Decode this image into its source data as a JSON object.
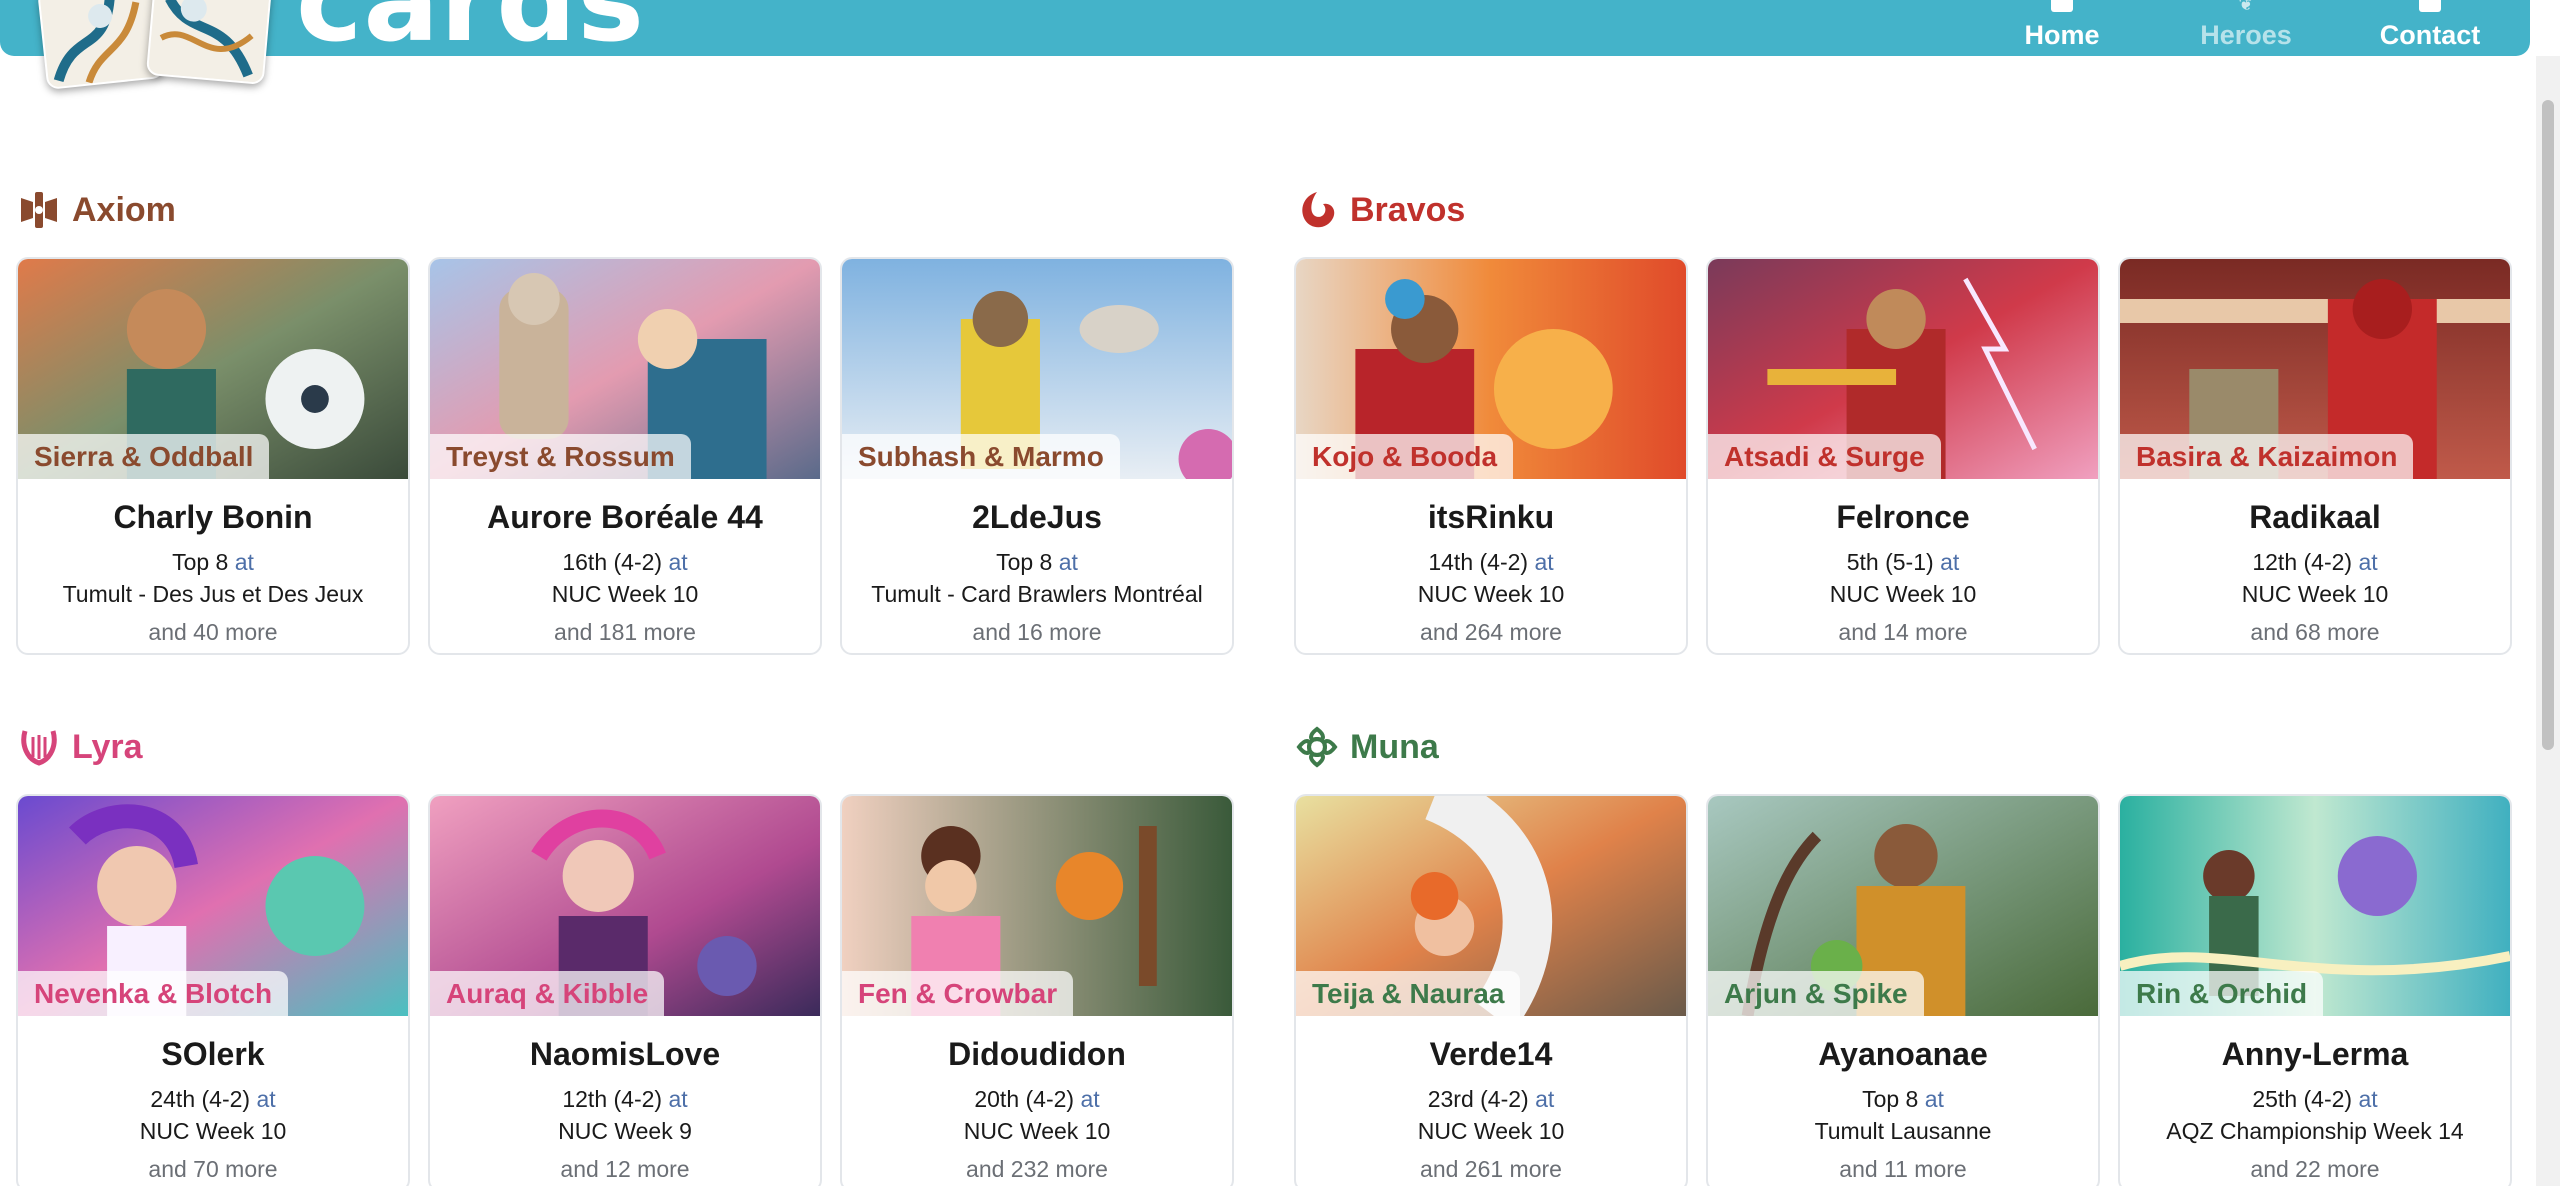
{
  "header": {
    "brand": "cards",
    "nav": [
      {
        "label": "Home",
        "icon": "home-icon"
      },
      {
        "label": "Heroes",
        "icon": "laurel-icon"
      },
      {
        "label": "Contact",
        "icon": "mail-icon"
      }
    ]
  },
  "colors": {
    "header": "#44b3c9",
    "axiom": "#8a4a2e",
    "bravos": "#c0312c",
    "lyra": "#d6447a",
    "muna": "#3d7a4a",
    "at_link": "#4d6fa8"
  },
  "factions": [
    {
      "name": "Axiom",
      "icon": "axiom-icon",
      "cards": [
        {
          "hero": "Sierra & Oddball",
          "player": "Charly Bonin",
          "result": "Top 8",
          "at": "at",
          "event": "Tumult - Des Jus et Des Jeux",
          "more": "and 40 more"
        },
        {
          "hero": "Treyst & Rossum",
          "player": "Aurore Boréale 44",
          "result": "16th (4-2)",
          "at": "at",
          "event": "NUC Week 10",
          "more": "and 181 more"
        },
        {
          "hero": "Subhash & Marmo",
          "player": "2LdeJus",
          "result": "Top 8",
          "at": "at",
          "event": "Tumult - Card Brawlers Montréal",
          "more": "and 16 more"
        }
      ]
    },
    {
      "name": "Bravos",
      "icon": "bravos-icon",
      "cards": [
        {
          "hero": "Kojo & Booda",
          "player": "itsRinku",
          "result": "14th (4-2)",
          "at": "at",
          "event": "NUC Week 10",
          "more": "and 264 more"
        },
        {
          "hero": "Atsadi & Surge",
          "player": "Felronce",
          "result": "5th (5-1)",
          "at": "at",
          "event": "NUC Week 10",
          "more": "and 14 more"
        },
        {
          "hero": "Basira & Kaizaimon",
          "player": "Radikaal",
          "result": "12th (4-2)",
          "at": "at",
          "event": "NUC Week 10",
          "more": "and 68 more"
        }
      ]
    },
    {
      "name": "Lyra",
      "icon": "lyre-icon",
      "cards": [
        {
          "hero": "Nevenka & Blotch",
          "player": "SOlerk",
          "result": "24th (4-2)",
          "at": "at",
          "event": "NUC Week 10",
          "more": "and 70 more"
        },
        {
          "hero": "Auraq & Kibble",
          "player": "NaomisLove",
          "result": "12th (4-2)",
          "at": "at",
          "event": "NUC Week 9",
          "more": "and 12 more"
        },
        {
          "hero": "Fen & Crowbar",
          "player": "Didoudidon",
          "result": "20th (4-2)",
          "at": "at",
          "event": "NUC Week 10",
          "more": "and 232 more"
        }
      ]
    },
    {
      "name": "Muna",
      "icon": "muna-icon",
      "cards": [
        {
          "hero": "Teija & Nauraa",
          "player": "Verde14",
          "result": "23rd (4-2)",
          "at": "at",
          "event": "NUC Week 10",
          "more": "and 261 more"
        },
        {
          "hero": "Arjun & Spike",
          "player": "Ayanoanae",
          "result": "Top 8",
          "at": "at",
          "event": "Tumult Lausanne",
          "more": "and 11 more"
        },
        {
          "hero": "Rin & Orchid",
          "player": "Anny-Lerma",
          "result": "25th (4-2)",
          "at": "at",
          "event": "AQZ Championship Week 14",
          "more": "and 22 more"
        }
      ]
    }
  ]
}
